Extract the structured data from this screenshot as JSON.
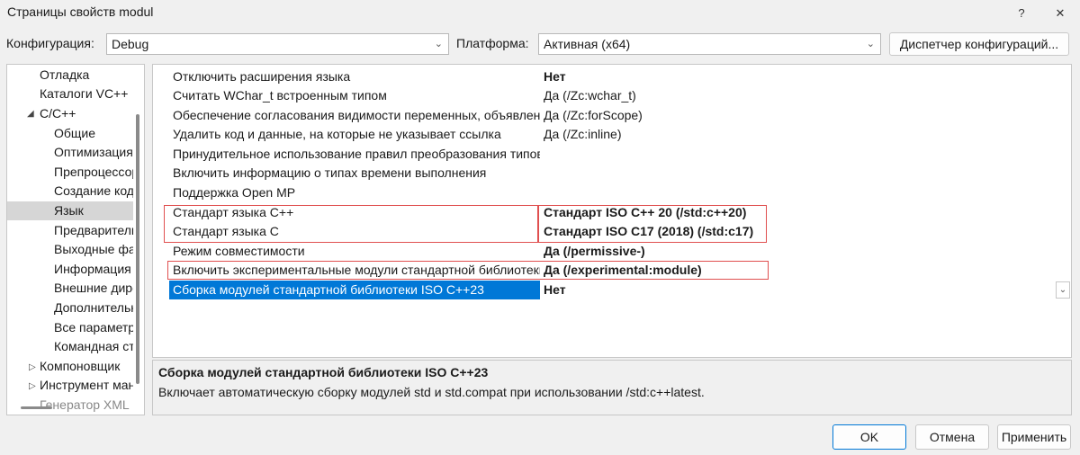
{
  "window": {
    "title": "Страницы свойств modul",
    "help_label": "?",
    "close_label": "✕"
  },
  "config": {
    "config_label": "Конфигурация:",
    "config_value": "Debug",
    "platform_label": "Платформа:",
    "platform_value": "Активная (x64)",
    "manager_button": "Диспетчер конфигураций..."
  },
  "tree": {
    "items": [
      {
        "label": "Отладка"
      },
      {
        "label": "Каталоги VC++"
      },
      {
        "label": "C/C++"
      },
      {
        "label": "Общие"
      },
      {
        "label": "Оптимизация"
      },
      {
        "label": "Препроцессор"
      },
      {
        "label": "Создание кода"
      },
      {
        "label": "Язык"
      },
      {
        "label": "Предварительно откомпилированные заголовки"
      },
      {
        "label": "Выходные файлы"
      },
      {
        "label": "Информация об обзоре"
      },
      {
        "label": "Внешние директивы включения"
      },
      {
        "label": "Дополнительно"
      },
      {
        "label": "Все параметры"
      },
      {
        "label": "Командная строка"
      },
      {
        "label": "Компоновщик"
      },
      {
        "label": "Инструмент манифеста"
      },
      {
        "label": "Генератор XML"
      }
    ]
  },
  "grid": {
    "rows": [
      {
        "name": "Отключить расширения языка",
        "value": "Нет"
      },
      {
        "name": "Считать WChar_t встроенным типом",
        "value": "Да (/Zc:wchar_t)"
      },
      {
        "name": "Обеспечение согласования видимости переменных, объявленных в операторе for",
        "value": "Да (/Zc:forScope)"
      },
      {
        "name": "Удалить код и данные, на которые не указывает ссылка",
        "value": "Да (/Zc:inline)"
      },
      {
        "name": "Принудительное использование правил преобразования типов",
        "value": ""
      },
      {
        "name": "Включить информацию о типах времени выполнения",
        "value": ""
      },
      {
        "name": "Поддержка Open MP",
        "value": ""
      },
      {
        "name": "Стандарт языка C++",
        "value": "Стандарт ISO C++ 20 (/std:c++20)"
      },
      {
        "name": "Стандарт языка C",
        "value": "Стандарт ISO C17 (2018) (/std:c17)"
      },
      {
        "name": "Режим совместимости",
        "value": "Да (/permissive-)"
      },
      {
        "name": "Включить экспериментальные модули стандартной библиотеки C++",
        "value": "Да (/experimental:module)"
      },
      {
        "name": "Сборка модулей стандартной библиотеки ISO C++23",
        "value": "Нет"
      }
    ]
  },
  "description": {
    "title": "Сборка модулей стандартной библиотеки ISO C++23",
    "text": "Включает автоматическую сборку модулей std и std.compat при использовании /std:c++latest."
  },
  "footer": {
    "ok": "OK",
    "cancel": "Отмена",
    "apply": "Применить"
  }
}
